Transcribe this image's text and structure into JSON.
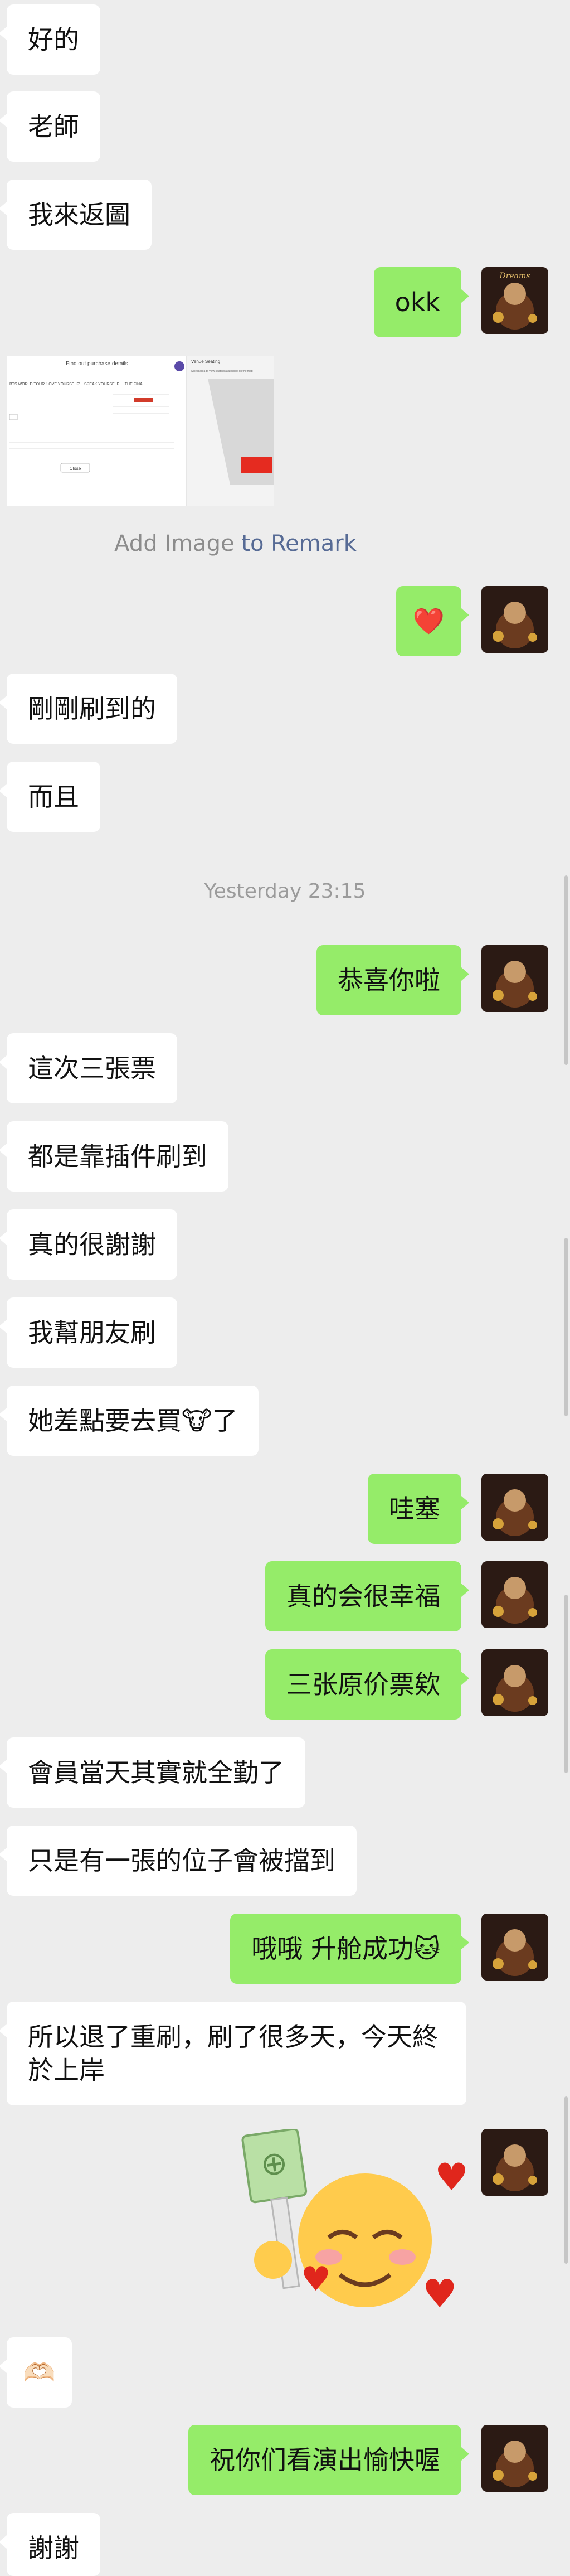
{
  "messages": {
    "m1": "好的",
    "m2": "老師",
    "m3": "我來返圖",
    "m4": "okk",
    "m5": "❤️",
    "m6": "剛剛刷到的",
    "m7": "而且",
    "m8": "恭喜你啦",
    "m9": "這次三張票",
    "m10": "都是靠插件刷到",
    "m11": "真的很謝謝",
    "m12": "我幫朋友刷",
    "m13": "她差點要去買🐮了",
    "m14": "哇塞",
    "m15": "真的会很幸福",
    "m16": "三张原价票欸",
    "m17": "會員當天其實就全勤了",
    "m18": "只是有一張的位子會被擋到",
    "m19": "哦哦 升舱成功🐱",
    "m20": "所以退了重刷，刷了很多天，今天終於上岸",
    "m21": "🫶🏻",
    "m22": "祝你们看演出愉快喔",
    "m23": "謝謝"
  },
  "timestamp": "Yesterday 23:15",
  "remark": {
    "prefix": "Add Image",
    "link": "to Remark"
  },
  "thumbnail": {
    "title": "Find out purchase details",
    "subtitle": "BTS WORLD TOUR 'LOVE YOURSELF' ~ SPEAK YOURSELF ~ [THE FINAL]",
    "button": "Close",
    "panel_header": "Venue Seating",
    "panel_subheader": "Select area to view seating availability on the map"
  },
  "avatar": {
    "label": "Dreams"
  }
}
